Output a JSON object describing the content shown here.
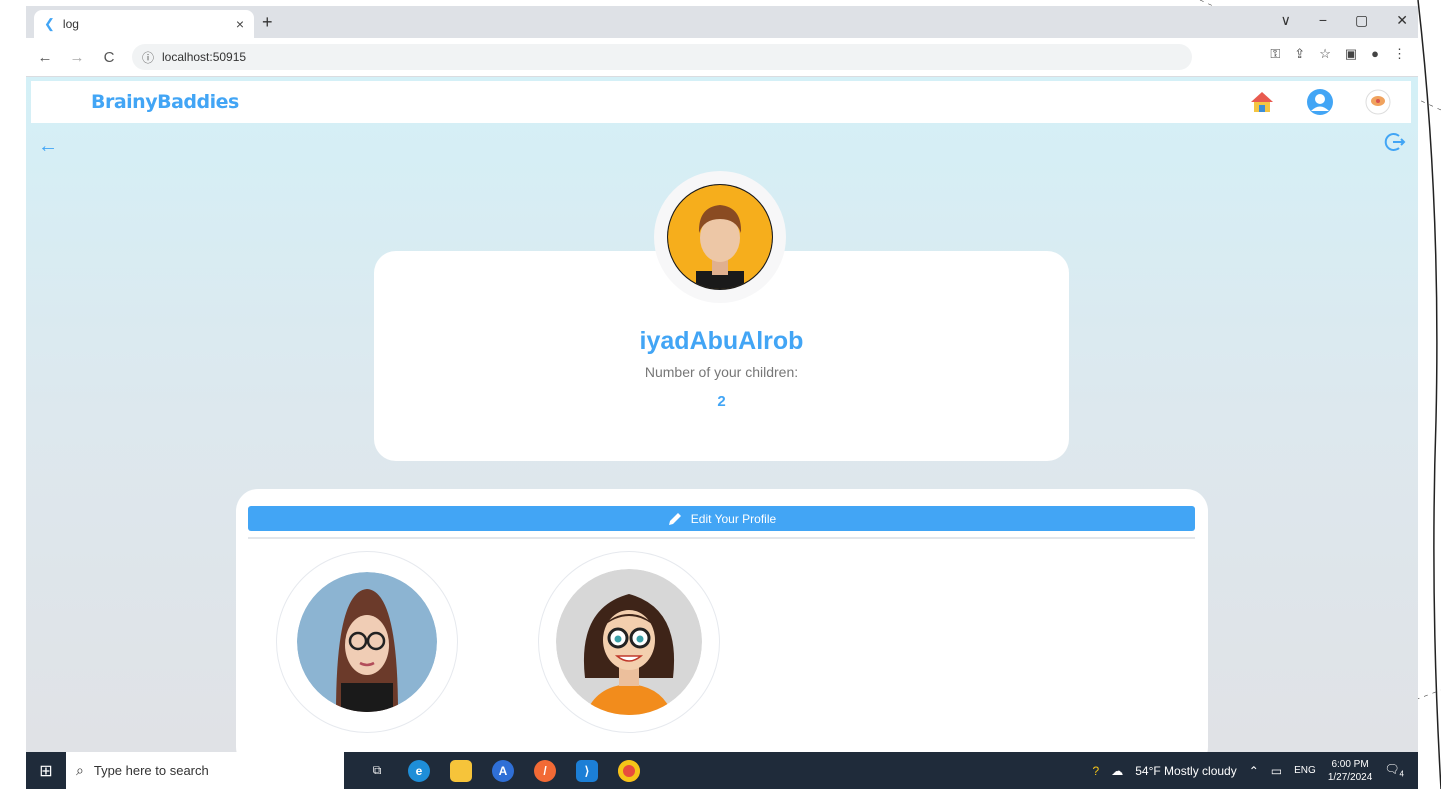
{
  "browser": {
    "tab_title": "log",
    "tab_close": "×",
    "new_tab": "+",
    "url": "localhost:50915",
    "window_controls": [
      "∨",
      "−",
      "▢",
      "✕"
    ]
  },
  "app": {
    "brand": "BrainyBaddies",
    "username": "iyadAbuAlrob",
    "children_label": "Number of your children:",
    "children_count": "2",
    "edit_label": "Edit Your Profile"
  },
  "taskbar": {
    "search_placeholder": "Type here to search",
    "weather": "54°F  Mostly cloudy",
    "language": "ENG",
    "time": "6:00 PM",
    "date": "1/27/2024",
    "notification_count": "4"
  },
  "colors": {
    "accent": "#42a5f5",
    "taskbar": "#1f2b3a"
  },
  "icons": [
    "flutter-icon",
    "back-arrow-icon",
    "forward-arrow-icon",
    "reload-icon",
    "info-icon",
    "key-icon",
    "share-icon",
    "star-icon",
    "sidepanel-icon",
    "profile-icon",
    "menu-icon",
    "home-icon",
    "user-icon",
    "chat-icon",
    "logout-icon",
    "pencil-icon",
    "windows-icon",
    "search-icon",
    "task-view-icon",
    "edge-icon",
    "file-explorer-icon",
    "app-store-icon",
    "postman-icon",
    "vscode-icon",
    "chrome-icon",
    "help-icon",
    "weather-icon",
    "notification-icon"
  ]
}
